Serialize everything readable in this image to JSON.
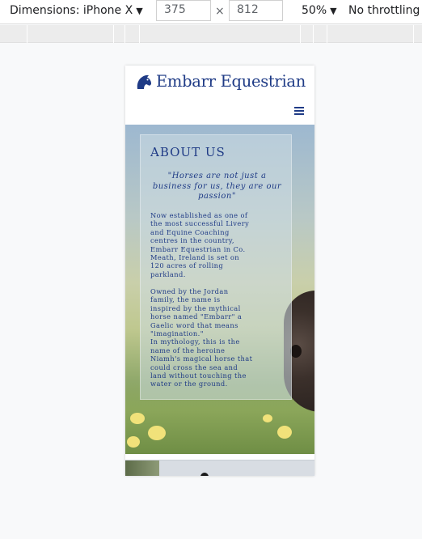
{
  "devtools": {
    "dimensions_label": "Dimensions: iPhone X",
    "width_value": "375",
    "times_sign": "×",
    "height_value": "812",
    "zoom_label": "50%",
    "throttling_label": "No throttling",
    "caret_icon": "caret-down-icon"
  },
  "site": {
    "brand_name": "Embarr Equestrian",
    "logo_icon": "horse-head-icon",
    "menu_icon": "hamburger-menu-icon",
    "brand_color": "#1f3b86"
  },
  "about": {
    "title": "ABOUT US",
    "quote": "\"Horses are not just a business for us, they are our passion\"",
    "paragraph1": "Now established as one of\nthe most successful Livery\nand Equine Coaching\ncentres in the country,\nEmbarr Equestrian in Co.\nMeath, Ireland is set on\n120 acres of rolling\nparkland.",
    "paragraph2": "Owned by the Jordan\nfamily, the name is\ninspired by the mythical\nhorse named \"Embarr\" a\nGaelic word that means\n\"imagination.\"\nIn mythology, this is the\nname of the heroine\nNiamh's magical horse that\ncould cross the sea and\nland without touching the\nwater or the ground."
  }
}
